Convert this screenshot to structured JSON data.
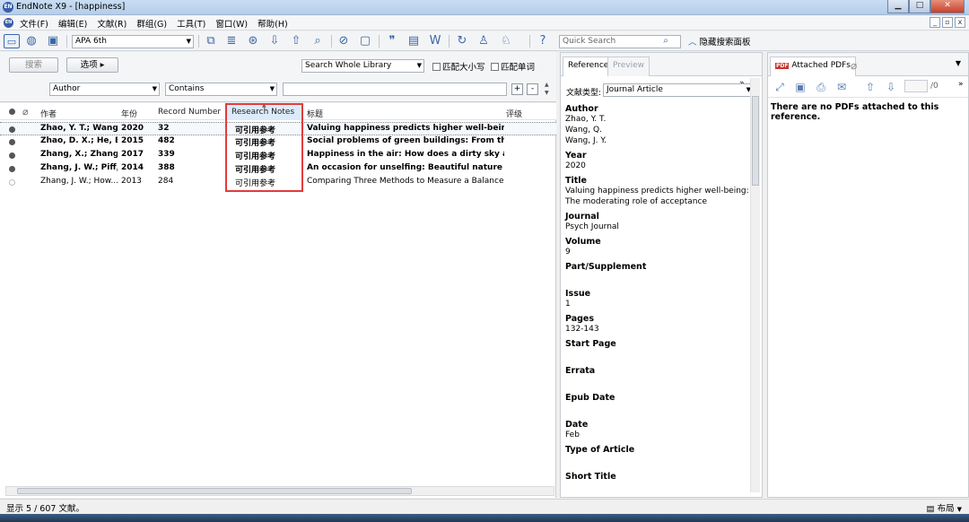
{
  "window": {
    "title": "EndNote X9 - [happiness]",
    "minimize": "▁",
    "maximize": "□",
    "close": "✕",
    "app_badge": "EN"
  },
  "menubar": {
    "items": [
      "文件(F)",
      "编辑(E)",
      "文献(R)",
      "群组(G)",
      "工具(T)",
      "窗口(W)",
      "帮助(H)"
    ],
    "mdi": [
      "_",
      "▫",
      "x"
    ]
  },
  "toolbar": {
    "style": "APA 6th",
    "quick_search_placeholder": "Quick Search",
    "hide_search_label": "隐藏搜索面板",
    "help_icon": "?"
  },
  "search_panel": {
    "search_button": "搜索",
    "options_button": "选项",
    "scope": "Search Whole Library",
    "match_case": "匹配大小写",
    "match_words": "匹配单词",
    "field": "Author",
    "operator": "Contains",
    "plus": "+",
    "minus": "-"
  },
  "ref_list": {
    "columns": [
      "作者",
      "年份",
      "Record Number",
      "Research Notes",
      "标题",
      "评级"
    ],
    "rows": [
      {
        "author": "Zhao, Y. T.; Wang...",
        "year": "2020",
        "record": "32",
        "notes": "可引用参考",
        "title": "Valuing happiness predicts higher well-being: T...",
        "unread": true
      },
      {
        "author": "Zhao, D. X.; He, B...",
        "year": "2015",
        "record": "482",
        "notes": "可引用参考",
        "title": "Social problems of green buildings: From the h...",
        "unread": true
      },
      {
        "author": "Zhang, X.; Zhang,...",
        "year": "2017",
        "record": "339",
        "notes": "可引用参考",
        "title": "Happiness in the air: How does a dirty sky affec...",
        "unread": true
      },
      {
        "author": "Zhang, J. W.; Piff,...",
        "year": "2014",
        "record": "388",
        "notes": "可引用参考",
        "title": "An occasion for unselfing: Beautiful nature lead...",
        "unread": true
      },
      {
        "author": "Zhang, J. W.; How...",
        "year": "2013",
        "record": "284",
        "notes": "可引用参考",
        "title": "Comparing Three Methods to Measure a Balance...",
        "unread": false
      }
    ]
  },
  "reference_panel": {
    "tabs": [
      "Reference",
      "Preview"
    ],
    "type_label": "文献类型:",
    "type_value": "Journal Article",
    "fields": [
      {
        "label": "Author",
        "values": [
          "Zhao, Y. T.",
          "Wang, Q.",
          "Wang, J. Y."
        ]
      },
      {
        "label": "Year",
        "values": [
          "2020"
        ]
      },
      {
        "label": "Title",
        "values": [
          "Valuing happiness predicts higher well-being: The moderating role of acceptance"
        ]
      },
      {
        "label": "Journal",
        "values": [
          "Psych Journal"
        ]
      },
      {
        "label": "Volume",
        "values": [
          "9"
        ]
      },
      {
        "label": "Part/Supplement",
        "values": []
      },
      {
        "label": "Issue",
        "values": [
          "1"
        ]
      },
      {
        "label": "Pages",
        "values": [
          "132-143"
        ]
      },
      {
        "label": "Start Page",
        "values": []
      },
      {
        "label": "Errata",
        "values": []
      },
      {
        "label": "Epub Date",
        "values": []
      },
      {
        "label": "Date",
        "values": [
          "Feb"
        ]
      },
      {
        "label": "Type of Article",
        "values": []
      },
      {
        "label": "Short Title",
        "values": []
      }
    ]
  },
  "pdf_panel": {
    "tab": "Attached PDFs",
    "page_count": "/0",
    "message": "There are no PDFs attached to this reference."
  },
  "statusbar": {
    "status": "显示 5 / 607 文献。",
    "layout": "布局"
  }
}
